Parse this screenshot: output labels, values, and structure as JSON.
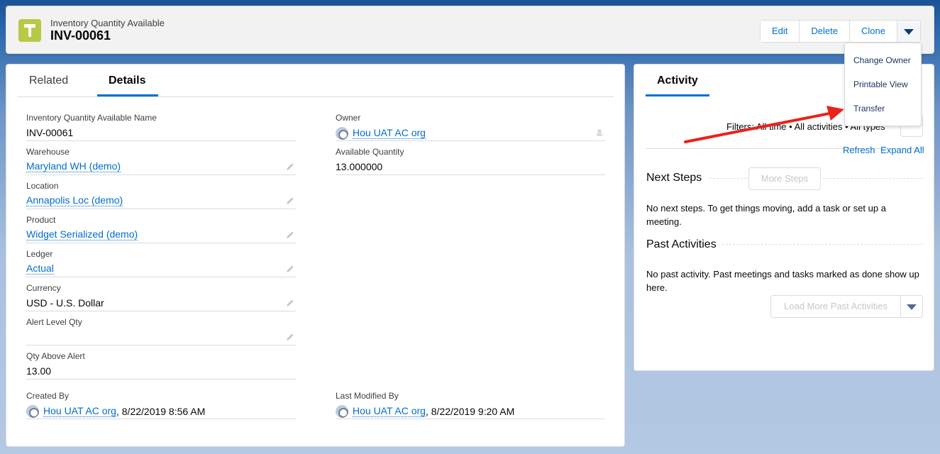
{
  "header": {
    "object_label": "Inventory Quantity Available",
    "record_title": "INV-00061",
    "icon": "tool-icon",
    "buttons": {
      "edit": "Edit",
      "delete": "Delete",
      "clone": "Clone"
    }
  },
  "dropdown": {
    "items": [
      "Change Owner",
      "Printable View",
      "Transfer"
    ]
  },
  "tabs": {
    "related": "Related",
    "details": "Details"
  },
  "fields": {
    "name_label": "Inventory Quantity Available Name",
    "name_value": "INV-00061",
    "owner_label": "Owner",
    "owner_value": "Hou UAT AC org",
    "warehouse_label": "Warehouse",
    "warehouse_value": "Maryland WH (demo)",
    "available_label": "Available Quantity",
    "available_value": "13.000000",
    "location_label": "Location",
    "location_value": "Annapolis Loc (demo)",
    "product_label": "Product",
    "product_value": "Widget Serialized (demo)",
    "ledger_label": "Ledger",
    "ledger_value": "Actual",
    "currency_label": "Currency",
    "currency_value": "USD - U.S. Dollar",
    "alert_label": "Alert Level Qty",
    "alert_value": "",
    "qty_above_label": "Qty Above Alert",
    "qty_above_value": "13.00",
    "created_label": "Created By",
    "created_user": "Hou UAT AC org",
    "created_date": ", 8/22/2019 8:56 AM",
    "modified_label": "Last Modified By",
    "modified_user": "Hou UAT AC org",
    "modified_date": ", 8/22/2019 9:20 AM"
  },
  "activity": {
    "tab": "Activity",
    "filters": "Filters: All time • All activities • All types",
    "refresh": "Refresh",
    "expand_all": "Expand All",
    "next_steps_title": "Next Steps",
    "more_steps": "More Steps",
    "next_steps_empty": "No next steps. To get things moving, add a task or set up a meeting.",
    "past_title": "Past Activities",
    "past_empty": "No past activity. Past meetings and tasks marked as done show up here.",
    "load_more": "Load More Past Activities"
  },
  "colors": {
    "accent": "#0070d2",
    "link": "#006dcc",
    "icon_bg": "#b7c946",
    "arrow": "#e8231c"
  }
}
